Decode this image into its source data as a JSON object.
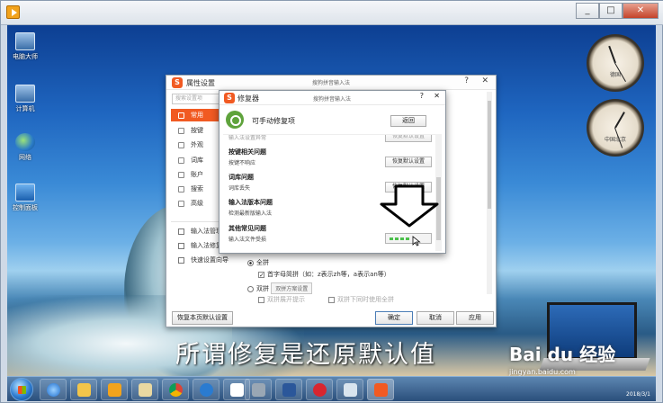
{
  "window": {
    "minimize": "_",
    "restore": "□",
    "close": "✕"
  },
  "desktop_icons": [
    {
      "label": "电脑大师",
      "icon": "computer-icon"
    },
    {
      "label": "计算机",
      "icon": "computer-icon"
    },
    {
      "label": "网络",
      "icon": "network-globe-icon"
    },
    {
      "label": "控制面板",
      "icon": "control-panel-icon"
    }
  ],
  "clocks": [
    {
      "label": "德国"
    },
    {
      "label": "中国北京"
    }
  ],
  "props": {
    "title": "属性设置",
    "center_title": "搜狗拼音输入法",
    "help": "?",
    "close": "✕",
    "search_placeholder": "搜索设置项",
    "nav": [
      "常用",
      "按键",
      "外观",
      "词库",
      "账户",
      "搜索",
      "高级"
    ],
    "nav_bottom": [
      "输入法管理",
      "输入法修复",
      "快速设置向导"
    ],
    "quanpin": "全拼",
    "shoumu": "首字母简拼（如：z表示zh等，a表示an等）",
    "shuangpin": "双拼",
    "shuangpin_btn": "双拼方案设置",
    "sp_hint": "双拼展开提示",
    "sp_quanpin": "双拼下同时使用全拼",
    "restore_default": "恢复本页默认设置",
    "ok": "确定",
    "cancel": "取消",
    "apply": "应用"
  },
  "repair": {
    "title": "修复器",
    "center_title": "搜狗拼音输入法",
    "help": "?",
    "close": "✕",
    "heading": "可手动修复项",
    "back": "返回",
    "top_item": "输入法设置异常",
    "top_btn": "恢复默认设置",
    "groups": [
      {
        "title": "按键相关问题",
        "item": "按键不响应",
        "button": "恢复默认设置"
      },
      {
        "title": "词库问题",
        "item": "词库丢失",
        "button": "恢复默认设置"
      },
      {
        "title": "输入法版本问题",
        "item": "检测最新版输入法",
        "button": ""
      },
      {
        "title": "其他常见问题",
        "item": "输入法文件受损",
        "button": ""
      }
    ]
  },
  "caption": "所谓修复是还原默认值",
  "watermark": {
    "brand": "Bai du 经验",
    "url": "jingyan.baidu.com"
  },
  "taskbar": {
    "apps": [
      "ie-icon",
      "folder-icon",
      "media-player-icon",
      "explorer-icon",
      "chrome-icon",
      "search-app-icon",
      "document-icon",
      "tools-icon",
      "word-icon",
      "app-red-icon",
      "settings-app-icon",
      "sogou-icon"
    ],
    "date": "2018/3/1"
  }
}
